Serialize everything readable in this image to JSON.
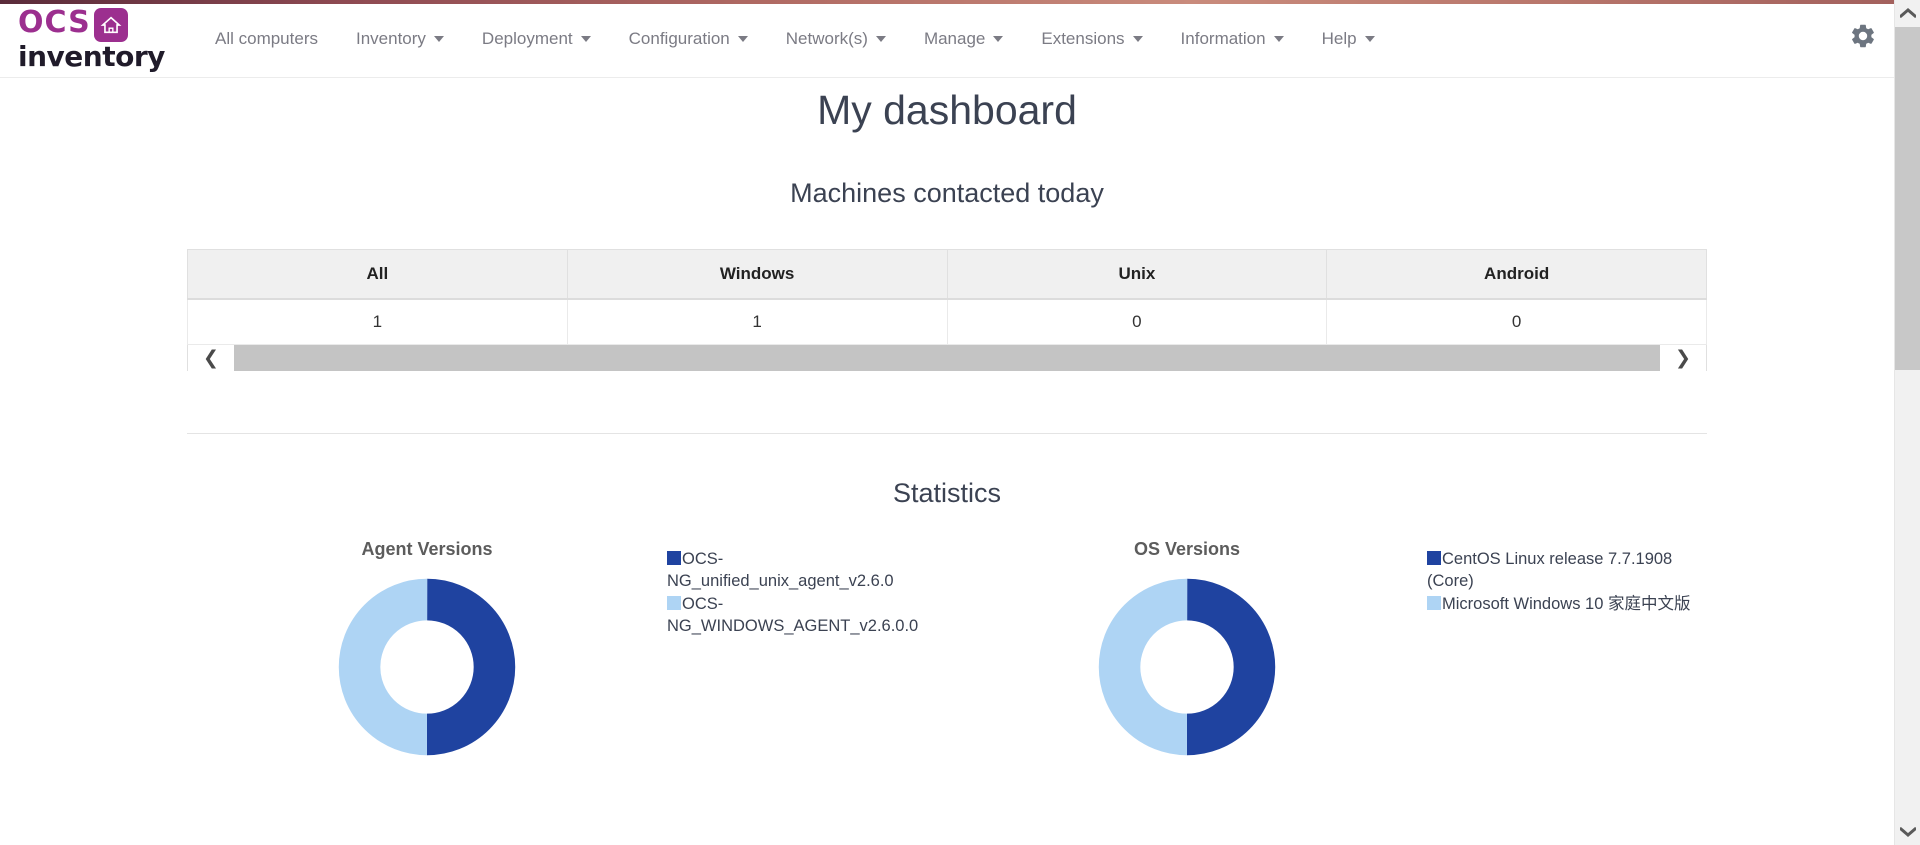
{
  "brand": {
    "ocs_text": "OCS",
    "inventory_text": "inventory",
    "house_icon": "house-icon",
    "brand_color": "#9c2f8f"
  },
  "navbar": {
    "items": [
      {
        "label": "All computers",
        "has_caret": false
      },
      {
        "label": "Inventory",
        "has_caret": true
      },
      {
        "label": "Deployment",
        "has_caret": true
      },
      {
        "label": "Configuration",
        "has_caret": true
      },
      {
        "label": "Network(s)",
        "has_caret": true
      },
      {
        "label": "Manage",
        "has_caret": true
      },
      {
        "label": "Extensions",
        "has_caret": true
      },
      {
        "label": "Information",
        "has_caret": true
      },
      {
        "label": "Help",
        "has_caret": true
      }
    ],
    "settings_icon": "gear-icon"
  },
  "page": {
    "title": "My dashboard",
    "machines_section_title": "Machines contacted today",
    "statistics_section_title": "Statistics"
  },
  "machines_table": {
    "columns": [
      "All",
      "Windows",
      "Unix",
      "Android"
    ],
    "row": [
      {
        "value": "1",
        "highlight": true
      },
      {
        "value": "1",
        "highlight": true
      },
      {
        "value": "0",
        "highlight": false
      },
      {
        "value": "0",
        "highlight": false
      }
    ],
    "scroll_left_icon": "chevron-left-icon",
    "scroll_right_icon": "chevron-right-icon",
    "link_color": "#9c2170"
  },
  "chart_data": [
    {
      "type": "pie",
      "title": "Agent Versions",
      "donut": true,
      "legend_position": "right",
      "categories": [
        "OCS-NG_unified_unix_agent_v2.6.0",
        "OCS-NG_WINDOWS_AGENT_v2.6.0.0"
      ],
      "values": [
        1,
        1
      ],
      "percentages": [
        50,
        50
      ],
      "colors": [
        "#1f43a0",
        "#aed4f4"
      ]
    },
    {
      "type": "pie",
      "title": "OS Versions",
      "donut": true,
      "legend_position": "right",
      "categories": [
        "CentOS Linux release 7.7.1908 (Core)",
        "Microsoft Windows 10 家庭中文版"
      ],
      "values": [
        1,
        1
      ],
      "percentages": [
        50,
        50
      ],
      "colors": [
        "#1f43a0",
        "#aed4f4"
      ]
    }
  ],
  "scrollbar": {
    "up_icon": "chevron-up-icon",
    "down_icon": "chevron-down-icon"
  }
}
